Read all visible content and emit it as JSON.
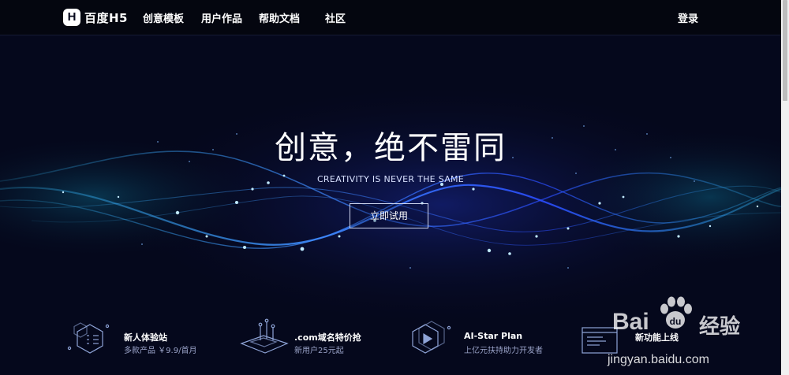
{
  "nav": {
    "logo_text": "百度H5",
    "logo_mark": "H",
    "items": [
      {
        "label": "创意模板"
      },
      {
        "label": "用户作品"
      },
      {
        "label": "帮助文档"
      },
      {
        "label": "社区"
      }
    ],
    "login": "登录"
  },
  "hero": {
    "headline": "创意，绝不雷同",
    "subline": "CREATIVITY IS NEVER THE SAME",
    "cta": "立即试用"
  },
  "features": [
    {
      "title": "新人体验站",
      "desc": "多款产品 ￥9.9/首月",
      "icon": "hexagon-list-icon"
    },
    {
      "title": ".com域名特价抢",
      "desc": "新用户25元起",
      "icon": "isometric-board-icon"
    },
    {
      "title": "AI-Star Plan",
      "desc": "上亿元扶持助力开发者",
      "icon": "hexagon-play-icon"
    },
    {
      "title": "新功能上线",
      "desc": "",
      "icon": "browser-window-icon"
    }
  ],
  "watermark": {
    "brand": "Bai",
    "brand_suffix": "经验",
    "url": "jingyan.baidu.com"
  },
  "colors": {
    "background": "#05081c",
    "wave_cyan": "#35c8ff",
    "wave_blue": "#1e3cff",
    "accent_glow": "#2a6cff"
  }
}
